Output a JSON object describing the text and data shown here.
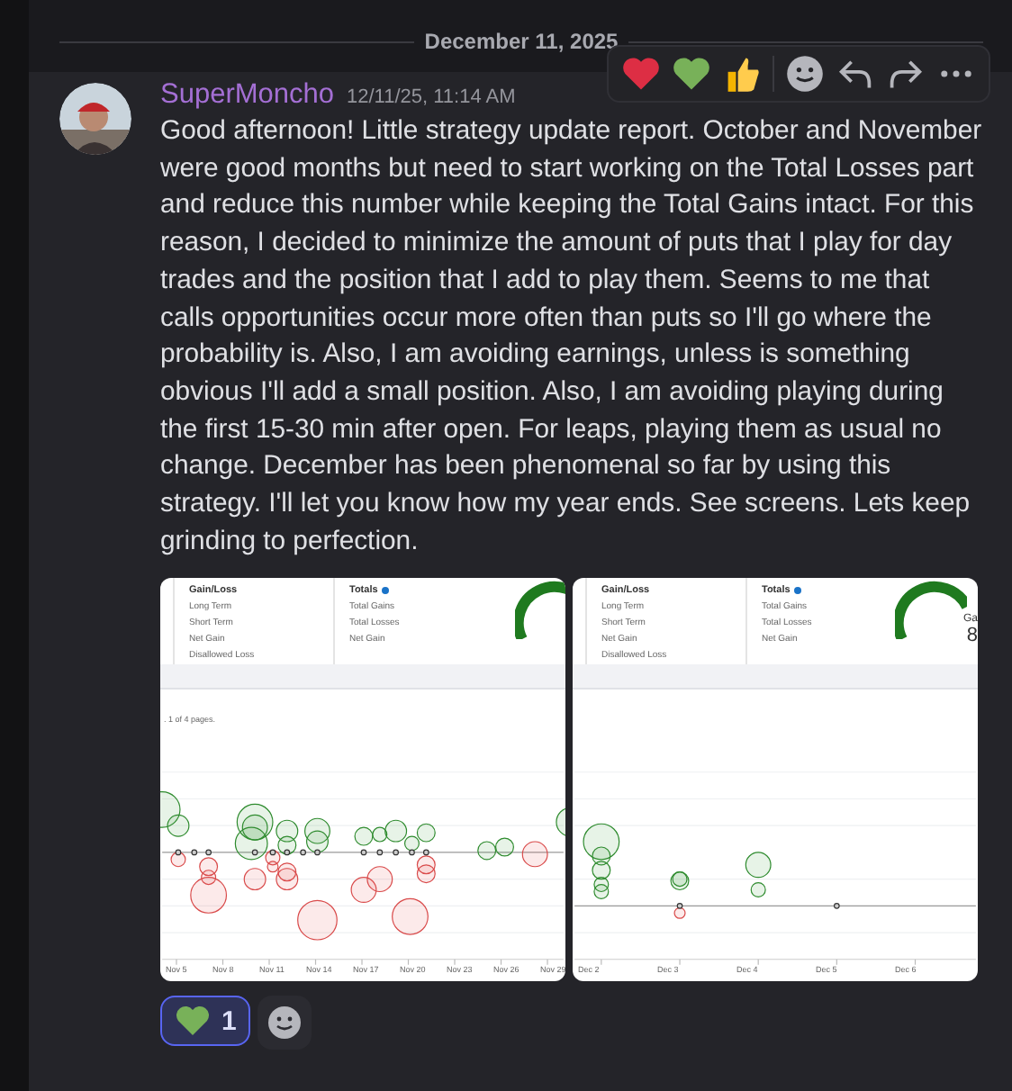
{
  "date_divider": "December 11, 2025",
  "message": {
    "username": "SuperMoncho",
    "timestamp": "12/11/25, 11:14 AM",
    "text": "Good afternoon! Little strategy update report. October and November were good months but need to start working on the Total Losses part and reduce this number while keeping the Total Gains intact. For this reason, I decided to minimize the amount of puts that I play for day trades and the position that I add to play them. Seems to me that calls opportunities occur more often than puts so I'll go where the probability is. Also, I am avoiding earnings, unless is something obvious I'll add a small position. Also, I am avoiding playing during the first 15-30  min after open. For leaps, playing them as usual no change. December has been phenomenal so far by using this strategy. I'll let you know how my year ends. See screens. Lets keep grinding to perfection."
  },
  "attachments": [
    {
      "gain_loss": {
        "title": "Gain/Loss",
        "items": [
          "Long Term",
          "Short Term",
          "Net Gain",
          "Disallowed Loss"
        ]
      },
      "totals": {
        "title": "Totals",
        "items": [
          "Total Gains",
          "Total Losses",
          "Net Gain"
        ]
      },
      "pagination": ". 1 of 4 pages.",
      "x_labels": [
        "Nov 5",
        "Nov 8",
        "Nov 11",
        "Nov 14",
        "Nov 17",
        "Nov 20",
        "Nov 23",
        "Nov 26",
        "Nov 29"
      ]
    },
    {
      "gain_loss": {
        "title": "Gain/Loss",
        "items": [
          "Long Term",
          "Short Term",
          "Net Gain",
          "Disallowed Loss"
        ]
      },
      "totals": {
        "title": "Totals",
        "items": [
          "Total Gains",
          "Total Losses",
          "Net Gain"
        ]
      },
      "gauge_text": [
        "Ga",
        "8"
      ],
      "x_labels": [
        "Dec 2",
        "Dec 3",
        "Dec 4",
        "Dec 5",
        "Dec 6"
      ]
    }
  ],
  "reactions": [
    {
      "count": "1",
      "selected": true
    }
  ]
}
